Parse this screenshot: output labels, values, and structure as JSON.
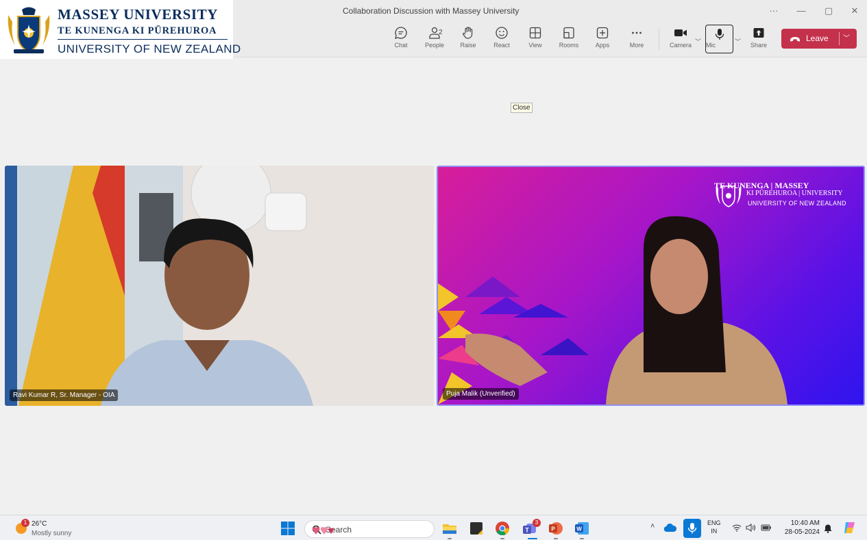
{
  "logo": {
    "line1": "MASSEY UNIVERSITY",
    "line2": "TE KUNENGA KI PŪREHUROA",
    "line3": "UNIVERSITY OF NEW ZEALAND"
  },
  "window": {
    "title": "Collaboration Discussion with Massey University",
    "controls": {
      "more": "···",
      "minimize": "—",
      "restore": "▢",
      "close": "✕"
    }
  },
  "toolbar": {
    "chat": "Chat",
    "people": "People",
    "people_count": "2",
    "raise": "Raise",
    "react": "React",
    "view": "View",
    "rooms": "Rooms",
    "apps": "Apps",
    "more": "More",
    "camera": "Camera",
    "mic": "Mic",
    "share": "Share",
    "leave": "Leave"
  },
  "stage": {
    "close_tooltip": "Close",
    "participants": [
      {
        "name": "Ravi Kumar R, Sr. Manager - OIA"
      },
      {
        "name": "Puja Malik (Unverified)"
      }
    ],
    "background_brand": {
      "line1": "TE KUNENGA | MASSEY",
      "line2": "KI PŪREHUROA | UNIVERSITY",
      "line3": "UNIVERSITY OF NEW ZEALAND"
    }
  },
  "taskbar": {
    "weather": {
      "temp": "26°C",
      "condition": "Mostly sunny",
      "badge": "1"
    },
    "search_placeholder": "Search",
    "teams_badge": "3",
    "language": {
      "line1": "ENG",
      "line2": "IN"
    },
    "clock": {
      "time": "10:40 AM",
      "date": "28-05-2024"
    }
  },
  "colors": {
    "leave_button": "#c4314b",
    "logo_navy": "#0b2d5c",
    "active_tile_border": "#8f8ff5"
  }
}
